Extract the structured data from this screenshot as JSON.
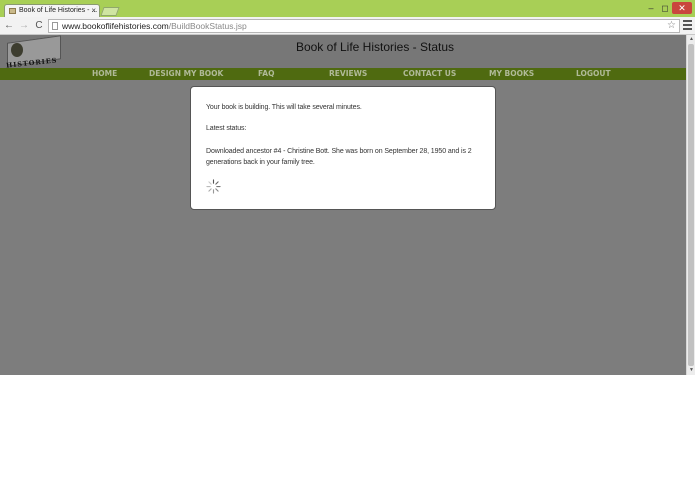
{
  "browser": {
    "tab_title": "Book of Life Histories - ...",
    "tab_close": "×",
    "url_domain": "www.bookoflifehistories.com",
    "url_path": "/BuildBookStatus.jsp",
    "star": "☆",
    "back": "←",
    "forward": "→",
    "reload": "C",
    "minimize": "‒",
    "maximize": "◻",
    "close": "✕"
  },
  "header": {
    "logo_text": "HISTORIES",
    "title": "Book of Life Histories - Status"
  },
  "nav": {
    "items": [
      {
        "label": "HOME"
      },
      {
        "label": "DESIGN MY BOOK"
      },
      {
        "label": "FAQ"
      },
      {
        "label": "REVIEWS"
      },
      {
        "label": "CONTACT US"
      },
      {
        "label": "MY BOOKS"
      },
      {
        "label": "LOGOUT"
      }
    ],
    "text_color": "#b0ba98",
    "bar_color": "#4f6a10"
  },
  "status_dialog": {
    "message": "Your book is building. This will take several minutes.",
    "latest_label": "Latest status:",
    "latest_status": "Downloaded ancestor #4 - Christine Bott. She was born on September 28, 1950 and is 2 generations back in your family tree."
  },
  "colors": {
    "overlay": "#7d7d7d",
    "titlebar": "#a8cf56"
  }
}
